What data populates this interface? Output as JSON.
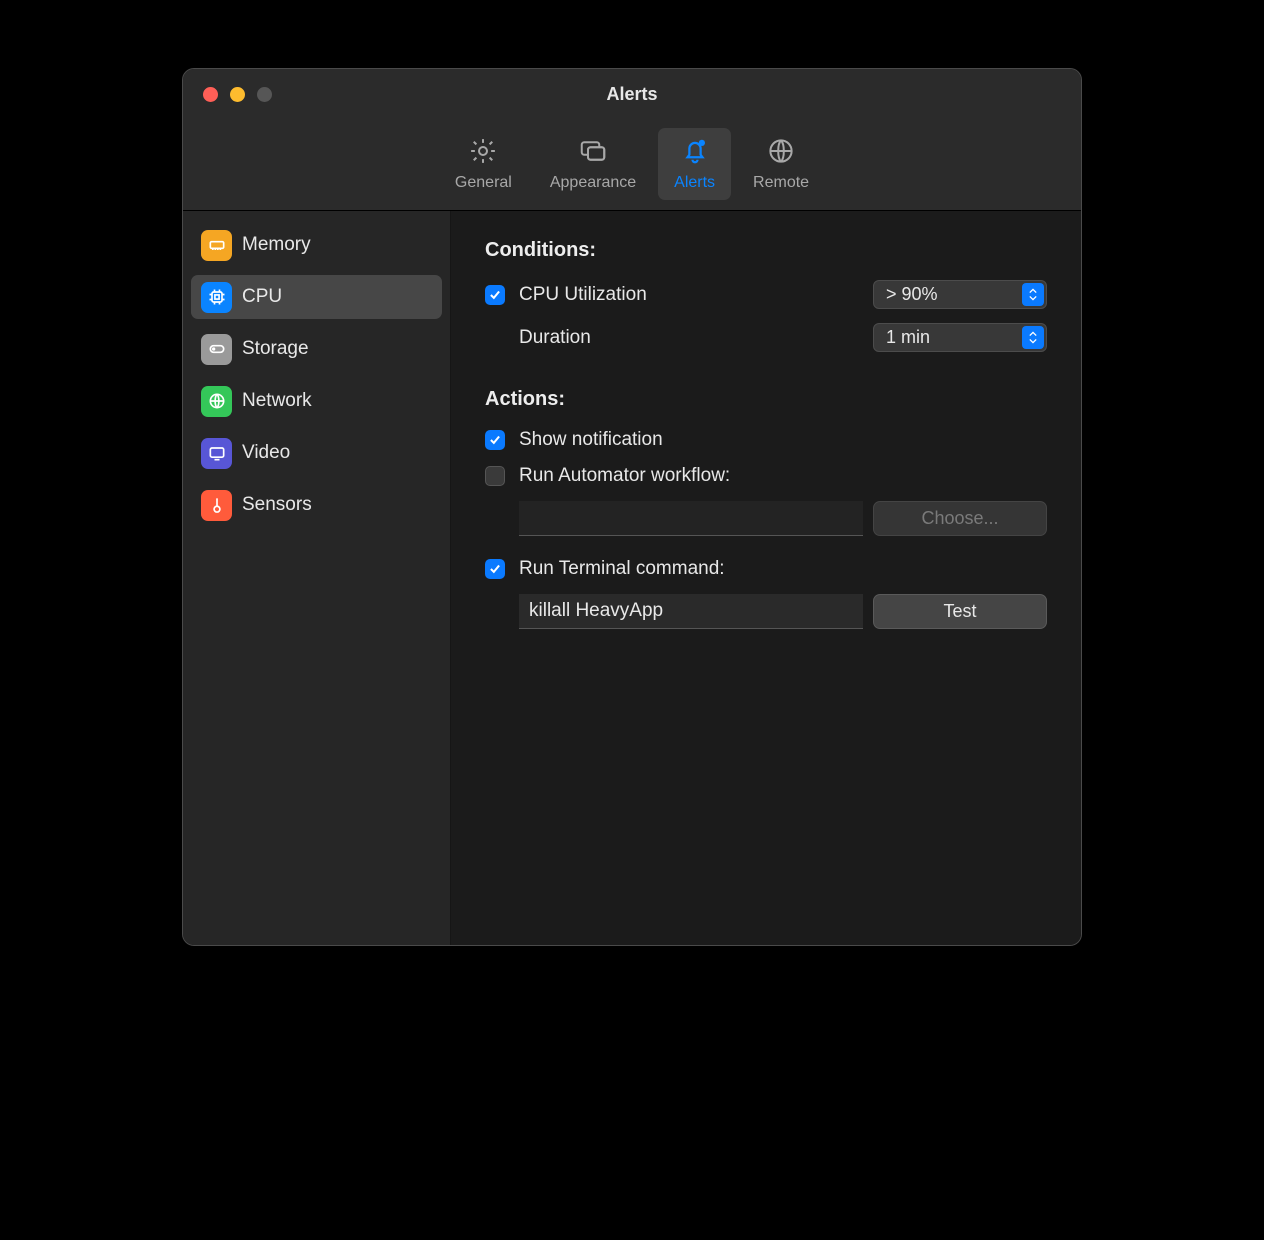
{
  "window": {
    "title": "Alerts"
  },
  "toolbar": {
    "general": "General",
    "appearance": "Appearance",
    "alerts": "Alerts",
    "remote": "Remote"
  },
  "sidebar": {
    "memory": "Memory",
    "cpu": "CPU",
    "storage": "Storage",
    "network": "Network",
    "video": "Video",
    "sensors": "Sensors"
  },
  "conditions": {
    "heading": "Conditions:",
    "cpu_util_label": "CPU Utilization",
    "cpu_util_value": "> 90%",
    "duration_label": "Duration",
    "duration_value": "1 min"
  },
  "actions": {
    "heading": "Actions:",
    "show_notification": "Show notification",
    "run_automator": "Run Automator workflow:",
    "automator_path": "",
    "choose": "Choose...",
    "run_terminal": "Run Terminal command:",
    "terminal_cmd": "killall HeavyApp",
    "test": "Test"
  },
  "colors": {
    "accent": "#0a84ff",
    "sidebar_memory": "#f5a623",
    "sidebar_cpu": "#0a84ff",
    "sidebar_storage": "#9a9a9a",
    "sidebar_network": "#34c759",
    "sidebar_video": "#5856d6",
    "sidebar_sensors": "#ff5b3b"
  }
}
